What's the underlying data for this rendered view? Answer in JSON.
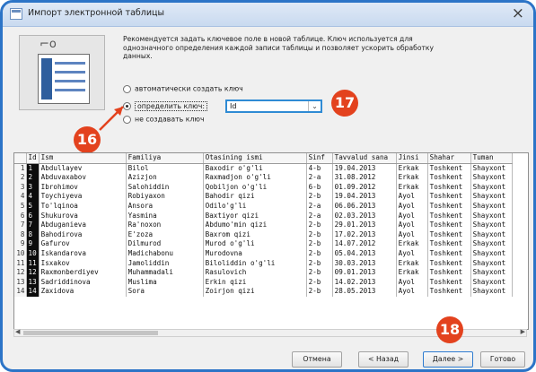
{
  "window": {
    "title": "Импорт электронной таблицы",
    "close_glyph": "×"
  },
  "description": "Рекомендуется задать ключевое поле в новой таблице. Ключ используется для однозначного определения каждой записи таблицы и позволяет ускорить обработку данных.",
  "options": [
    {
      "label": "автоматически создать ключ",
      "selected": false
    },
    {
      "label": "определить ключ:",
      "selected": true
    },
    {
      "label": "не создавать ключ",
      "selected": false
    }
  ],
  "key_field": {
    "value": "Id",
    "button_glyph": "⌄"
  },
  "callouts": {
    "a": "16",
    "b": "17",
    "c": "18"
  },
  "table": {
    "columns": [
      "Id",
      "Ism",
      "Familiya",
      "Otasining ismi",
      "Sinf",
      "Tavvalud sana",
      "Jinsi",
      "Shahar",
      "Tuman"
    ],
    "rows": [
      [
        "1",
        "1",
        "Abdullayev",
        "Bilol",
        "Baxodir o'g'li",
        "4-b",
        "19.04.2013",
        "Erkak",
        "Toshkent",
        "Shayxont"
      ],
      [
        "2",
        "2",
        "Abduvaxabov",
        "Azizjon",
        "Raxmadjon o'g'li",
        "2-a",
        "31.08.2012",
        "Erkak",
        "Toshkent",
        "Shayxont"
      ],
      [
        "3",
        "3",
        "Ibrohimov",
        "Salohiddin",
        "Qobiljon o'g'li",
        "6-b",
        "01.09.2012",
        "Erkak",
        "Toshkent",
        "Shayxont"
      ],
      [
        "4",
        "4",
        "Toychiyeva",
        "Robiyaxon",
        "Bahodir qizi",
        "2-b",
        "19.04.2013",
        "Ayol",
        "Toshkent",
        "Shayxont"
      ],
      [
        "5",
        "5",
        "To'lqinoa",
        "Ansora",
        "Odilo'g'li",
        "2-a",
        "06.06.2013",
        "Ayol",
        "Toshkent",
        "Shayxont"
      ],
      [
        "6",
        "6",
        "Shukurova",
        "Yasmina",
        "Baxtiyor qizi",
        "2-a",
        "02.03.2013",
        "Ayol",
        "Toshkent",
        "Shayxont"
      ],
      [
        "7",
        "7",
        "Abduganieva",
        "Ra'noxon",
        "Abdumo'min qizi",
        "2-b",
        "29.01.2013",
        "Ayol",
        "Toshkent",
        "Shayxont"
      ],
      [
        "8",
        "8",
        "Bahodirova",
        "E'zoza",
        "Baxrom qizi",
        "2-b",
        "17.02.2013",
        "Ayol",
        "Toshkent",
        "Shayxont"
      ],
      [
        "9",
        "9",
        "Gafurov",
        "Dilmurod",
        "Murod o'g'li",
        "2-b",
        "14.07.2012",
        "Erkak",
        "Toshkent",
        "Shayxont"
      ],
      [
        "10",
        "10",
        "Iskandarova",
        "Madichabonu",
        "Murodovna",
        "2-b",
        "05.04.2013",
        "Ayol",
        "Toshkent",
        "Shayxont"
      ],
      [
        "11",
        "11",
        "Isxakov",
        "Jamoliddin",
        "Biloliddin o'g'li",
        "2-b",
        "30.03.2013",
        "Erkak",
        "Toshkent",
        "Shayxont"
      ],
      [
        "12",
        "12",
        "Raxmonberdiyev",
        "Muhammadali",
        "Rasulovich",
        "2-b",
        "09.01.2013",
        "Erkak",
        "Toshkent",
        "Shayxont"
      ],
      [
        "13",
        "13",
        "Sadriddinova",
        "Muslima",
        "Erkin qizi",
        "2-b",
        "14.02.2013",
        "Ayol",
        "Toshkent",
        "Shayxont"
      ],
      [
        "14",
        "14",
        "Zaxidova",
        "Sora",
        "Zoirjon qizi",
        "2-b",
        "28.05.2013",
        "Ayol",
        "Toshkent",
        "Shayxont"
      ]
    ]
  },
  "buttons": {
    "cancel": "Отмена",
    "back": "< Назад",
    "next": "Далее >",
    "finish": "Готово"
  },
  "colors": {
    "callout": "#e3421e",
    "window_border": "#2c74c7",
    "key_field_border": "#2f8bd4"
  }
}
